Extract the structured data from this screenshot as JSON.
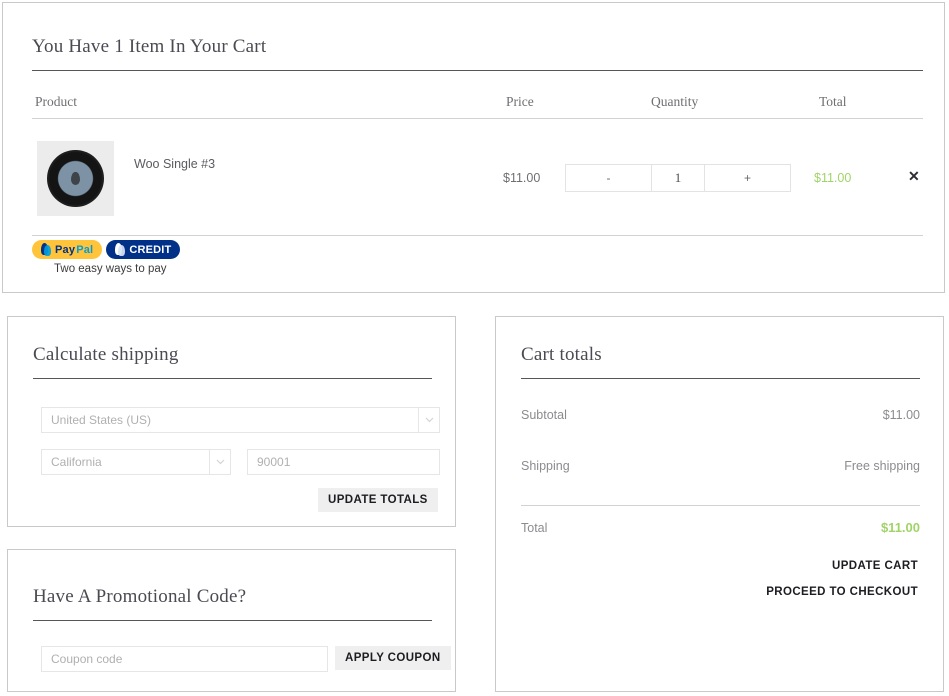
{
  "cart": {
    "title": "You Have 1 Item In Your Cart",
    "columns": {
      "product": "Product",
      "price": "Price",
      "quantity": "Quantity",
      "total": "Total"
    },
    "items": [
      {
        "name": "Woo Single #3",
        "price": "$11.00",
        "quantity": "1",
        "total": "$11.00",
        "decrease_label": "-",
        "increase_label": "+",
        "remove_label": "✕",
        "thumbnail_icon": "vinyl-record-image"
      }
    ]
  },
  "paypal": {
    "paypal_word1": "Pay",
    "paypal_word2": "Pal",
    "credit_label": "CREDIT",
    "caption": "Two easy ways to pay"
  },
  "shipping": {
    "title": "Calculate shipping",
    "country": "United States (US)",
    "state": "California",
    "postcode": "90001",
    "update_button": "UPDATE TOTALS"
  },
  "promo": {
    "title": "Have A Promotional Code?",
    "coupon_placeholder": "Coupon code",
    "coupon_value": "",
    "apply_button": "APPLY COUPON"
  },
  "totals": {
    "title": "Cart totals",
    "subtotal_label": "Subtotal",
    "subtotal_value": "$11.00",
    "shipping_label": "Shipping",
    "shipping_value": "Free shipping",
    "total_label": "Total",
    "total_value": "$11.00",
    "update_cart_link": "UPDATE CART",
    "checkout_link": "PROCEED TO CHECKOUT"
  },
  "colors": {
    "accent_green": "#a0d468",
    "paypal_yellow": "#ffc439",
    "paypal_navy": "#003087",
    "paypal_blue": "#009cde"
  }
}
